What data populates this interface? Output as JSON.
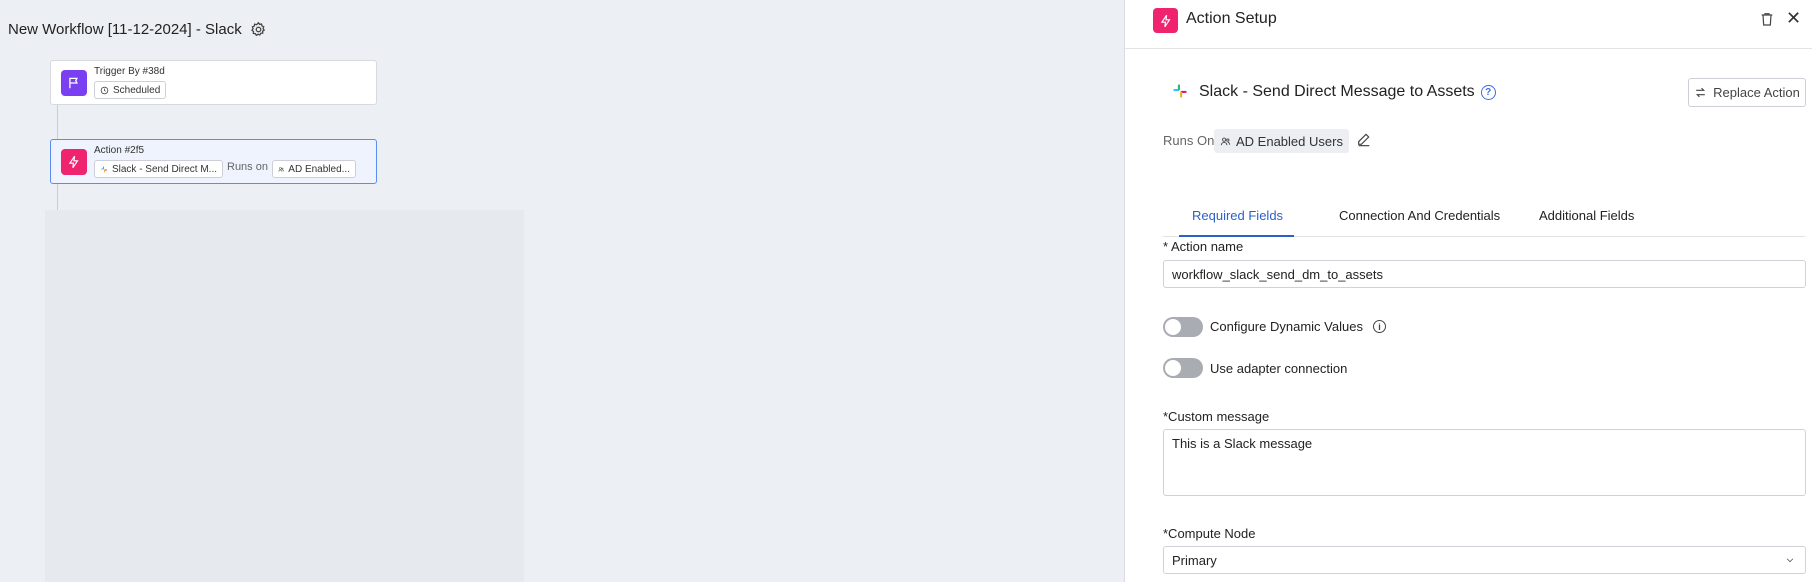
{
  "canvas": {
    "workflow_title": "New Workflow [11-12-2024] - Slack",
    "trigger_node": {
      "label": "Trigger By #38d",
      "chip": "Scheduled"
    },
    "action_node": {
      "label": "Action #2f5",
      "action_chip": "Slack - Send Direct M...",
      "runs_on": "Runs on",
      "target_chip": "AD Enabled..."
    }
  },
  "panel": {
    "header_title": "Action Setup",
    "close_glyph": "✕",
    "action_title": "Slack - Send Direct Message to Assets",
    "help_glyph": "?",
    "replace_button": "Replace Action",
    "runs_on_label": "Runs On",
    "runs_on_value": "AD Enabled Users",
    "tabs": [
      "Required Fields",
      "Connection And Credentials",
      "Additional Fields"
    ],
    "active_tab": "Required Fields",
    "fields": {
      "action_name_label": "* Action name",
      "action_name_value": "workflow_slack_send_dm_to_assets",
      "dynamic_values_label": "Configure Dynamic Values",
      "dynamic_values_on": false,
      "adapter_connection_label": "Use adapter connection",
      "adapter_connection_on": false,
      "custom_message_label": "*Custom message",
      "custom_message_value": "This is a Slack message",
      "compute_node_label": "*Compute Node",
      "compute_node_value": "Primary"
    },
    "info_glyph": "i"
  },
  "colors": {
    "accent": "#2c5fc9",
    "action_icon": "#f0236e",
    "trigger_icon": "#7b3ff2",
    "selected_border": "#5b8def"
  }
}
